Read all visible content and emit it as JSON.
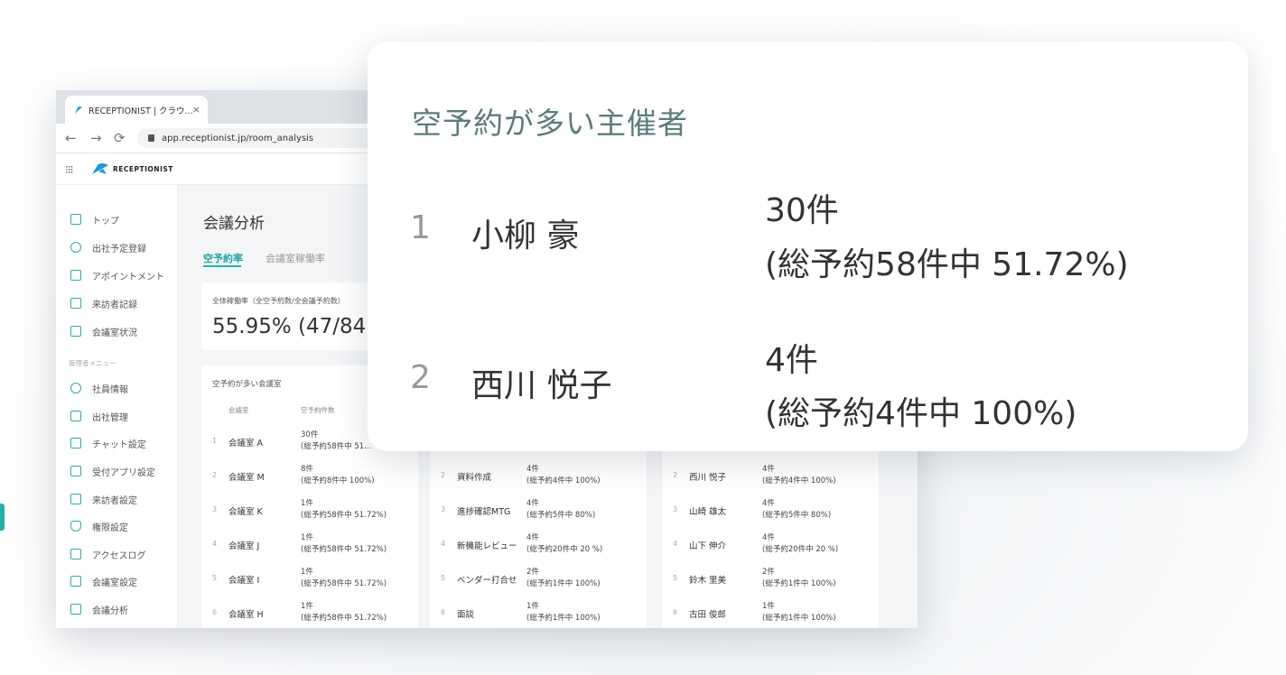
{
  "browser": {
    "tab_title": "RECEPTIONIST | クラウ...",
    "tab_close": "×",
    "url": "app.receptionist.jp/room_analysis",
    "back_icon": "←",
    "forward_icon": "→",
    "reload_icon": "⟳"
  },
  "app": {
    "brand": "RECEPTIONIST",
    "grid_icon": "⁝⁝⁝"
  },
  "sidebar": {
    "items": [
      {
        "label": "トップ",
        "icon": "home-icon"
      },
      {
        "label": "出社予定登録",
        "icon": "person-schedule-icon"
      },
      {
        "label": "アポイントメント",
        "icon": "calendar-icon"
      },
      {
        "label": "来訪者記録",
        "icon": "document-icon"
      },
      {
        "label": "会議室状況",
        "icon": "door-icon"
      }
    ],
    "section_label": "管理者メニュー",
    "admin_items": [
      {
        "label": "社員情報",
        "icon": "people-icon"
      },
      {
        "label": "出社管理",
        "icon": "building-icon"
      },
      {
        "label": "チャット設定",
        "icon": "calendar-icon"
      },
      {
        "label": "受付アプリ設定",
        "icon": "tablet-icon"
      },
      {
        "label": "来訪者設定",
        "icon": "document-icon"
      },
      {
        "label": "権限設定",
        "icon": "shield-icon"
      },
      {
        "label": "アクセスログ",
        "icon": "document-icon"
      },
      {
        "label": "会議室設定",
        "icon": "room-settings-icon"
      },
      {
        "label": "会議分析",
        "icon": "chart-icon"
      }
    ]
  },
  "main": {
    "title": "会議分析",
    "tabs": [
      "空予約率",
      "会議室稼働率"
    ],
    "rate_label": "全体稼働率（全空予約数/全会議予約数）",
    "rate_value": "55.95% (47/84",
    "card1": {
      "title": "空予約が多い会議室",
      "col_name": "会議室",
      "col_count": "空予約件数",
      "rows": [
        {
          "n": "1",
          "name": "会議室 A",
          "c1": "30件",
          "c2": "(総予約58件中  51..."
        },
        {
          "n": "2",
          "name": "会議室 M",
          "c1": "8件",
          "c2": "(総予約8件中  100%)"
        },
        {
          "n": "3",
          "name": "会議室 K",
          "c1": "1件",
          "c2": "(総予約58件中  51.72%)"
        },
        {
          "n": "4",
          "name": "会議室 J",
          "c1": "1件",
          "c2": "(総予約58件中  51.72%)"
        },
        {
          "n": "5",
          "name": "会議室 I",
          "c1": "1件",
          "c2": "(総予約58件中  51.72%)"
        },
        {
          "n": "6",
          "name": "会議室 H",
          "c1": "1件",
          "c2": "(総予約58件中  51.72%)"
        }
      ]
    },
    "card2": {
      "rows": [
        {
          "n": "2",
          "name": "資料作成",
          "c1": "4件",
          "c2": "(総予約4件中  100%)"
        },
        {
          "n": "3",
          "name": "進捗確認MTG",
          "c1": "4件",
          "c2": "(総予約5件中  80%)"
        },
        {
          "n": "4",
          "name": "新機能レビュー",
          "c1": "4件",
          "c2": "(総予約20件中  20 %)"
        },
        {
          "n": "5",
          "name": "ベンダー打合せ",
          "c1": "2件",
          "c2": "(総予約1件中  100%)"
        },
        {
          "n": "6",
          "name": "面談",
          "c1": "1件",
          "c2": "(総予約1件中  100%)"
        }
      ]
    },
    "card3": {
      "rows": [
        {
          "n": "2",
          "name": "西川 悦子",
          "c1": "4件",
          "c2": "(総予約4件中  100%)"
        },
        {
          "n": "3",
          "name": "山崎 雄太",
          "c1": "4件",
          "c2": "(総予約5件中  80%)"
        },
        {
          "n": "4",
          "name": "山下 伸介",
          "c1": "4件",
          "c2": "(総予約20件中  20 %)"
        },
        {
          "n": "5",
          "name": "鈴木 里美",
          "c1": "2件",
          "c2": "(総予約1件中  100%)"
        },
        {
          "n": "6",
          "name": "古田 俊郎",
          "c1": "1件",
          "c2": "(総予約1件中  100%)"
        }
      ]
    }
  },
  "popup": {
    "title": "空予約が多い主催者",
    "rows": [
      {
        "n": "1",
        "name": "小柳 豪",
        "c1": "30件",
        "c2": "(総予約58件中  51.72%)"
      },
      {
        "n": "2",
        "name": "西川 悦子",
        "c1": "4件",
        "c2": "(総予約4件中  100%)"
      }
    ]
  },
  "colors": {
    "accent": "#20b2aa",
    "popup_title": "#5a7d7b"
  }
}
